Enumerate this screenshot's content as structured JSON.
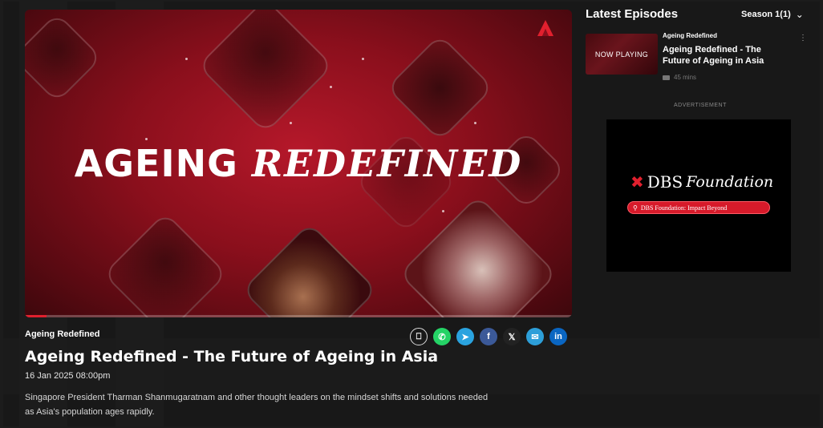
{
  "player": {
    "title_main": "AGEING",
    "title_script": "REDEFINED",
    "brand_icon": "cna-logo-icon",
    "progress_fraction": 0.04,
    "accent": "#e1202e"
  },
  "episode": {
    "show": "Ageing Redefined",
    "title": "Ageing Redefined - The Future of Ageing in Asia",
    "date": "16 Jan 2025 08:00pm",
    "description": "Singapore President Tharman Shanmugaratnam and other thought leaders on the mindset shifts and solutions needed as Asia's population ages rapidly."
  },
  "share": [
    {
      "name": "bookmark-icon",
      "glyph": "⎕"
    },
    {
      "name": "whatsapp-icon",
      "glyph": "✆"
    },
    {
      "name": "telegram-icon",
      "glyph": "➤"
    },
    {
      "name": "facebook-icon",
      "glyph": "f"
    },
    {
      "name": "x-icon",
      "glyph": "𝕏"
    },
    {
      "name": "email-icon",
      "glyph": "✉"
    },
    {
      "name": "linkedin-icon",
      "glyph": "in"
    }
  ],
  "sidebar": {
    "heading": "Latest Episodes",
    "season": "Season 1(1)",
    "item": {
      "thumb_label": "NOW PLAYING",
      "show": "Ageing Redefined",
      "title": "Ageing Redefined - The Future of Ageing in Asia",
      "duration": "45 mins"
    },
    "ad_label": "ADVERTISEMENT",
    "ad": {
      "brand": "DBS",
      "brand_script": "Foundation",
      "pill_text": "DBS Foundation: Impact Beyond"
    }
  }
}
